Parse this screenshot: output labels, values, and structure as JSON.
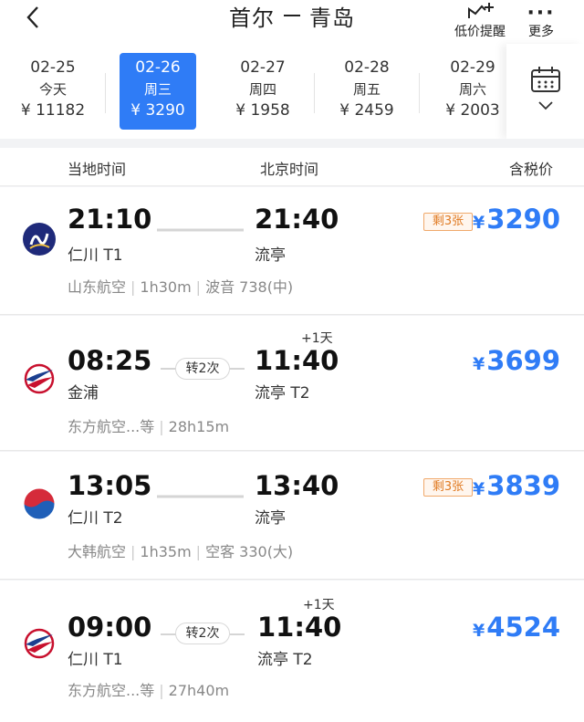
{
  "header": {
    "title_from": "首尔",
    "title_to": "青岛",
    "price_alert_label": "低价提醒",
    "more_label": "更多"
  },
  "dates": [
    {
      "date": "02-25",
      "weekday": "今天",
      "price": "¥ 11182",
      "active": false
    },
    {
      "date": "02-26",
      "weekday": "周三",
      "price": "¥ 3290",
      "active": true
    },
    {
      "date": "02-27",
      "weekday": "周四",
      "price": "¥ 1958",
      "active": false
    },
    {
      "date": "02-28",
      "weekday": "周五",
      "price": "¥ 2459",
      "active": false
    },
    {
      "date": "02-29",
      "weekday": "周六",
      "price": "¥ 2003",
      "active": false
    }
  ],
  "columns": {
    "local_time": "当地时间",
    "beijing_time": "北京时间",
    "price_incl_tax": "含税价"
  },
  "flights": [
    {
      "dep_time": "21:10",
      "dep_airport": "仁川 T1",
      "arr_time": "21:40",
      "arr_airport": "流亭",
      "plus_day": "",
      "transfer": "",
      "airline": "山东航空",
      "duration": "1h30m",
      "aircraft": "波音 738(中)",
      "seats_left": "剩3张",
      "currency": "¥",
      "price": "3290",
      "logo": "shandong-airlines-logo"
    },
    {
      "dep_time": "08:25",
      "dep_airport": "金浦",
      "arr_time": "11:40",
      "arr_airport": "流亭 T2",
      "plus_day": "+1天",
      "transfer": "转2次",
      "airline": "东方航空...等",
      "duration": "28h15m",
      "aircraft": "",
      "seats_left": "",
      "currency": "¥",
      "price": "3699",
      "logo": "china-eastern-logo"
    },
    {
      "dep_time": "13:05",
      "dep_airport": "仁川 T2",
      "arr_time": "13:40",
      "arr_airport": "流亭",
      "plus_day": "",
      "transfer": "",
      "airline": "大韩航空",
      "duration": "1h35m",
      "aircraft": "空客 330(大)",
      "seats_left": "剩3张",
      "currency": "¥",
      "price": "3839",
      "logo": "korean-air-logo"
    },
    {
      "dep_time": "09:00",
      "dep_airport": "仁川 T1",
      "arr_time": "11:40",
      "arr_airport": "流亭 T2",
      "plus_day": "+1天",
      "transfer": "转2次",
      "airline": "东方航空...等",
      "duration": "27h40m",
      "aircraft": "",
      "seats_left": "",
      "currency": "¥",
      "price": "4524",
      "logo": "china-eastern-logo"
    }
  ],
  "colors": {
    "accent": "#2f7cf6",
    "badge_text": "#e07a22",
    "badge_border": "#f0a86a"
  }
}
